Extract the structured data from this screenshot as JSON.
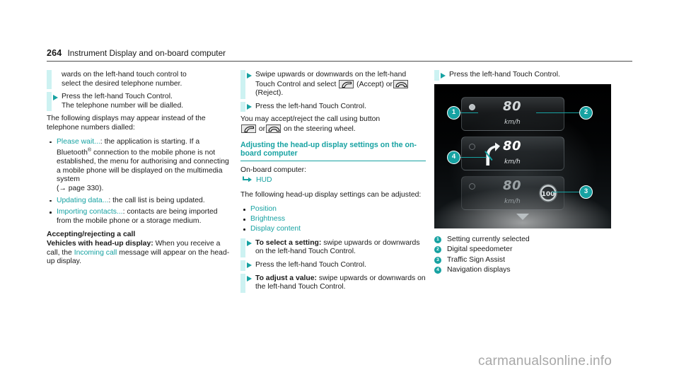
{
  "header": {
    "page_number": "264",
    "chapter": "Instrument Display and on-board computer"
  },
  "column1": {
    "instr_1_line1": "wards on the left-hand touch control to",
    "instr_1_line2": "select the desired telephone number.",
    "instr_2_line1": "Press the left-hand Touch Control.",
    "instr_2_line2": "The telephone number will be dialled.",
    "intro": "The following displays may appear instead of the telephone numbers dialled:",
    "bullets": [
      {
        "link": "Please wait...",
        "text_a": ": the application is starting. If a Bluetooth",
        "sup": "®",
        "text_b": " connection to the mobile phone is not established, the menu for authorising and connecting a mobile phone will be displayed on the multimedia system",
        "ref": "(→ page 330)."
      },
      {
        "link": "Updating data...",
        "text_a": ": the call list is being updated."
      },
      {
        "link": "Importing contacts...",
        "text_a": ": contacts are being imported from the mobile phone or a storage medium."
      }
    ],
    "heading": "Accepting/rejecting a call",
    "sub_heading": "Vehicles with head-up display:",
    "para_a": " When you receive a call, the ",
    "para_link": "Incoming call",
    "para_b": " message will appear on the head-up display."
  },
  "column2": {
    "instr_1_a": "Swipe upwards or downwards on the left-hand Touch Control and select ",
    "instr_1_accept": "(Accept)",
    "instr_1_or": "or",
    "instr_1_reject": "(Reject).",
    "instr_2": "Press the left-hand Touch Control.",
    "para_1_a": "You may accept/reject the call using button",
    "para_1_or": "or",
    "para_1_b": "on the steering wheel.",
    "section_heading": "Adjusting the head-up display settings on the on-board computer",
    "obc_label": "On-board computer:",
    "obc_path": "HUD",
    "obc_intro": "The following head-up display settings can be adjusted:",
    "settings": [
      "Position",
      "Brightness",
      "Display content"
    ],
    "instr_3_bold": "To select a setting:",
    "instr_3_text": " swipe upwards or downwards on the left-hand Touch Control.",
    "instr_4": "Press the left-hand Touch Control.",
    "instr_5_bold": "To adjust a value:",
    "instr_5_text": " swipe upwards or downwards on the left-hand Touch Control."
  },
  "column3": {
    "instr_1": "Press the left-hand Touch Control.",
    "figure": {
      "speed_value": "80",
      "speed_unit": "km/h",
      "speed_limit": "100",
      "callouts": [
        "1",
        "2",
        "3",
        "4"
      ]
    },
    "legend": [
      {
        "num": "1",
        "label": "Setting currently selected"
      },
      {
        "num": "2",
        "label": "Digital speedometer"
      },
      {
        "num": "3",
        "label": "Traffic Sign Assist"
      },
      {
        "num": "4",
        "label": "Navigation displays"
      }
    ]
  },
  "watermark": "carmanualsonline.info",
  "colors": {
    "accent_teal": "#17a2a2",
    "rule_light": "#cdf2f2",
    "text": "#1a1a1a",
    "watermark": "#a8a8a8"
  }
}
